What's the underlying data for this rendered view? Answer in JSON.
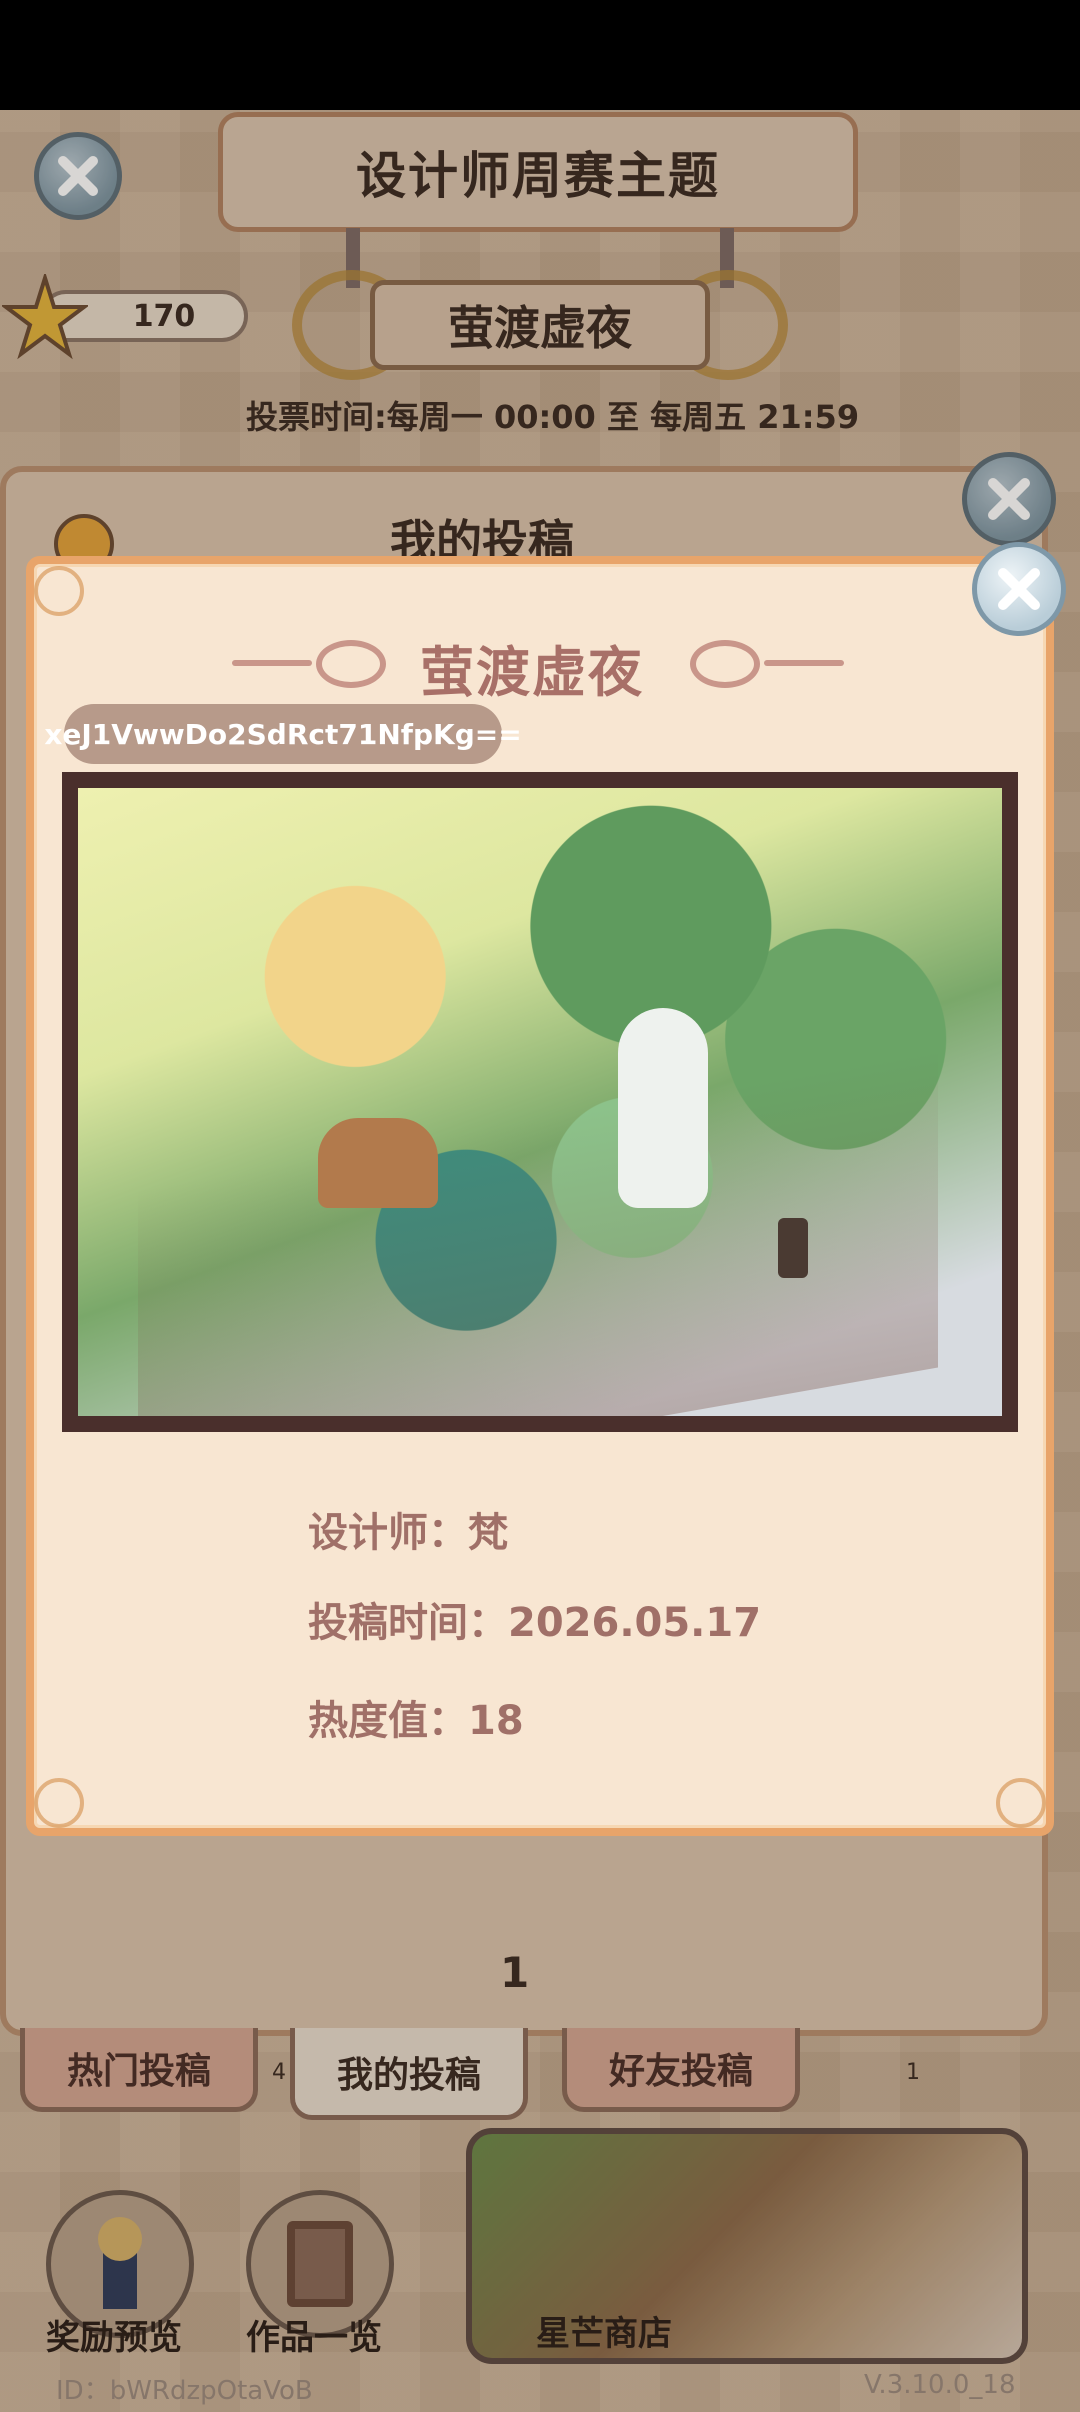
{
  "header": {
    "title": "设计师周赛主题",
    "theme_name": "萤渡虚夜",
    "vote_time": "投票时间:每周一 00:00 至 每周五 21:59",
    "star_count": "170"
  },
  "under_panel": {
    "header": "我的投稿",
    "page_number": "1"
  },
  "tabs": [
    {
      "label": "热门投稿",
      "badge": "4"
    },
    {
      "label": "我的投稿"
    },
    {
      "label": "好友投稿",
      "badge": "1"
    }
  ],
  "bottom": {
    "reward_preview": "奖励预览",
    "works_list": "作品一览",
    "shop": "星芒商店",
    "user_id": "ID：bWRdzpOtaVoB",
    "version": "V.3.10.0_18"
  },
  "modal": {
    "title": "萤渡虚夜",
    "code": "xeJ1VwwDo2SdRct71NfpKg==",
    "designer": "设计师：梵",
    "submit_time": "投稿时间：2026.05.17",
    "heat": "热度值：18"
  },
  "colors": {
    "modal_bg": "#f8e6d2",
    "modal_border": "#e8a46a",
    "title_text": "#a87068"
  },
  "icons": {
    "close": "close-icon",
    "star": "star-icon",
    "info": "info-icon"
  }
}
